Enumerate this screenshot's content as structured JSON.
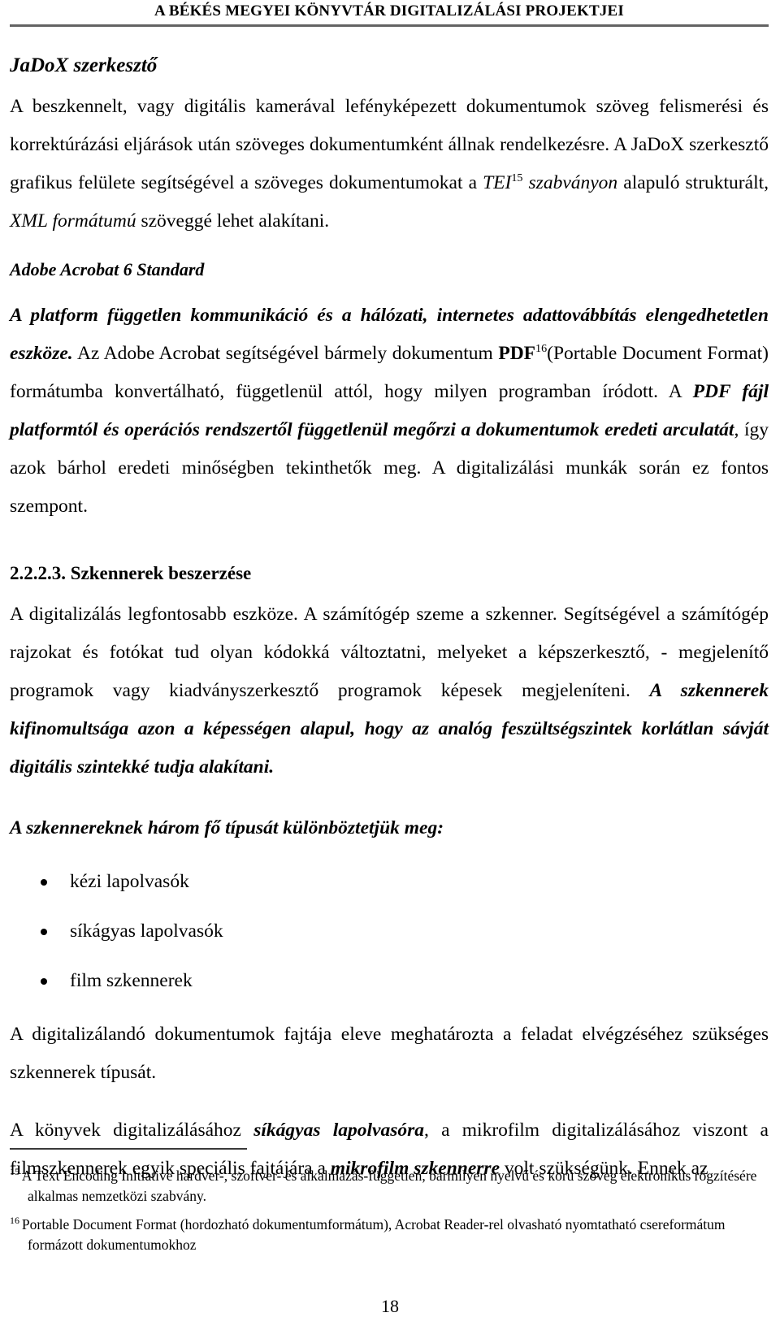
{
  "header": {
    "running_title": "A BÉKÉS MEGYEI KÖNYVTÁR DIGITALIZÁLÁSI PROJEKTJEI",
    "rule_color": "#636363"
  },
  "sections": {
    "jadox_heading": "JaDoX szerkesztő",
    "jadox_paragraph": {
      "part1": "A beszkennelt, vagy digitális kamerával lefényképezett dokumentumok szöveg felismerési és korrektúrázási eljárások után szöveges dokumentumként állnak rendelkezésre. A JaDoX szerkesztő grafikus felülete segítségével a szöveges dokumentumokat a ",
      "tei": "TEI",
      "tei_footnote_ref": "15",
      "part2": " szabványon",
      "part3": " alapuló strukturált, ",
      "xml": "XML formátumú",
      "part4": " szöveggé lehet alakítani."
    },
    "acrobat_heading": "Adobe Acrobat 6 Standard",
    "acrobat_paragraph": {
      "lead_bold_italic": "A platform független kommunikáció és a hálózati, internetes adattovábbítás elengedhetetlen eszköze.",
      "mid1": " Az Adobe Acrobat segítségével bármely dokumentum ",
      "pdf_bold": "PDF",
      "pdf_footnote_ref": "16",
      "mid2": "(Portable Document Format) formátumba konvertálható, függetlenül attól, hogy milyen programban íródott. A ",
      "emph_bold_italic": "PDF fájl platformtól és operációs rendszertől függetlenül megőrzi a dokumentumok eredeti arculatát",
      "mid3": ", így azok bárhol eredeti minőségben tekinthetők meg. A digitalizálási munkák során ez fontos szempont."
    },
    "scanner_heading": "2.2.2.3. Szkennerek beszerzése",
    "scanner_paragraph": {
      "part1": "A digitalizálás legfontosabb eszköze. A számítógép szeme a szkenner. Segítségével a számítógép rajzokat és fotókat tud olyan kódokká változtatni, melyeket a képszerkesztő, - megjelenítő programok vagy kiadványszerkesztő programok képesek megjeleníteni. ",
      "emph_bold_italic": "A szkennerek kifinomultsága azon a képességen alapul, hogy az analóg feszültségszintek korlátlan sávját digitális szintekké tudja alakítani."
    },
    "types_lead": "A szkennereknek három fő típusát különböztetjük meg:",
    "types_list": [
      "kézi lapolvasók",
      "síkágyas lapolvasók",
      "film szkennerek"
    ],
    "types_paragraph": "A digitalizálandó dokumentumok fajtája eleve meghatározta a feladat elvégzéséhez szükséges szkennerek típusát.",
    "final_paragraph": {
      "part1": "A könyvek digitalizálásához ",
      "emph1": "síkágyas lapolvasóra",
      "part2": ", a mikrofilm digitalizálásához viszont a filmszkennerek egyik speciális fajtájára a ",
      "emph2": "mikrofilm szkennerre",
      "part3": " volt szükségünk. Ennek az"
    }
  },
  "footnotes": [
    {
      "marker": "15",
      "text": "A Text Encoding Initiative hardver-, szoftver- és alkalmazás-független, bármilyen nyelvű és korú szöveg elektronikus rögzítésére alkalmas nemzetközi szabvány."
    },
    {
      "marker": "16",
      "text": "Portable Document Format (hordozható dokumentumformátum), Acrobat Reader-rel olvasható nyomtatható csereformátum formázott dokumentumokhoz"
    }
  ],
  "page_number": "18"
}
